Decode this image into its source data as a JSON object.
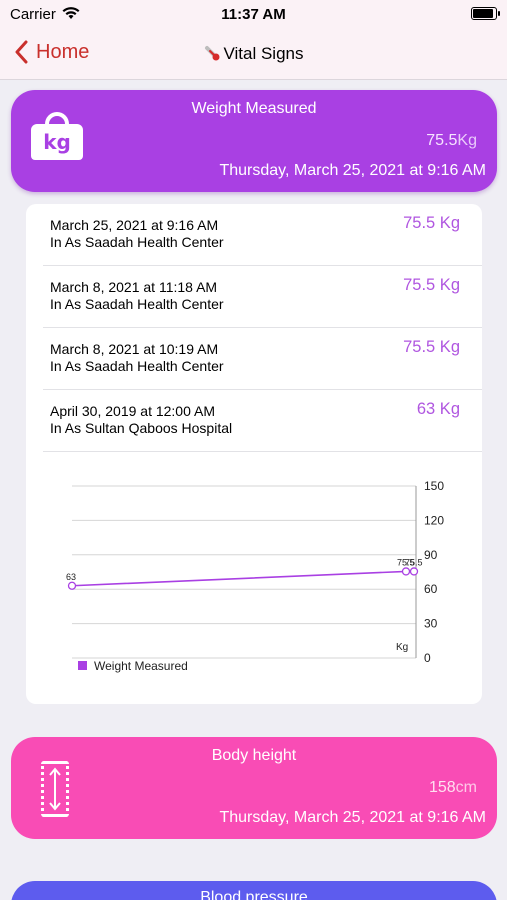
{
  "status_bar": {
    "carrier": "Carrier",
    "time": "11:37 AM"
  },
  "nav": {
    "back_label": "Home",
    "title": "Vital Signs"
  },
  "weight_card": {
    "title": "Weight Measured",
    "value": "75.5",
    "unit": "Kg",
    "date": "Thursday, March 25, 2021 at 9:16 AM",
    "icon_text": "kg",
    "color": "#a940e3"
  },
  "history": [
    {
      "date": "March 25, 2021 at 9:16 AM",
      "place": "In As Saadah Health Center",
      "value": "75.5 Kg"
    },
    {
      "date": "March 8, 2021 at 11:18 AM",
      "place": "In As Saadah Health Center",
      "value": "75.5 Kg"
    },
    {
      "date": "March 8, 2021 at 10:19 AM",
      "place": "In As Saadah Health Center",
      "value": "75.5 Kg"
    },
    {
      "date": "April 30, 2019 at 12:00 AM",
      "place": "In As Sultan Qaboos Hospital",
      "value": "63 Kg"
    }
  ],
  "chart_data": {
    "type": "line",
    "series": [
      {
        "name": "Weight Measured",
        "values": [
          63,
          75.5,
          75.5
        ],
        "point_labels": [
          "63",
          "75.5",
          "75.5"
        ]
      }
    ],
    "y_ticks": [
      0,
      30,
      60,
      90,
      120,
      150
    ],
    "ylim": [
      0,
      150
    ],
    "ylabel": "Kg",
    "legend": "bottom-left",
    "grid": true,
    "color": "#a940e3"
  },
  "height_card": {
    "title": "Body height",
    "value": "158",
    "unit": "cm",
    "date": "Thursday, March 25, 2021 at 9:16 AM",
    "color": "#f94cb5"
  },
  "bp_card": {
    "title": "Blood pressure",
    "color": "#5d5cee"
  }
}
